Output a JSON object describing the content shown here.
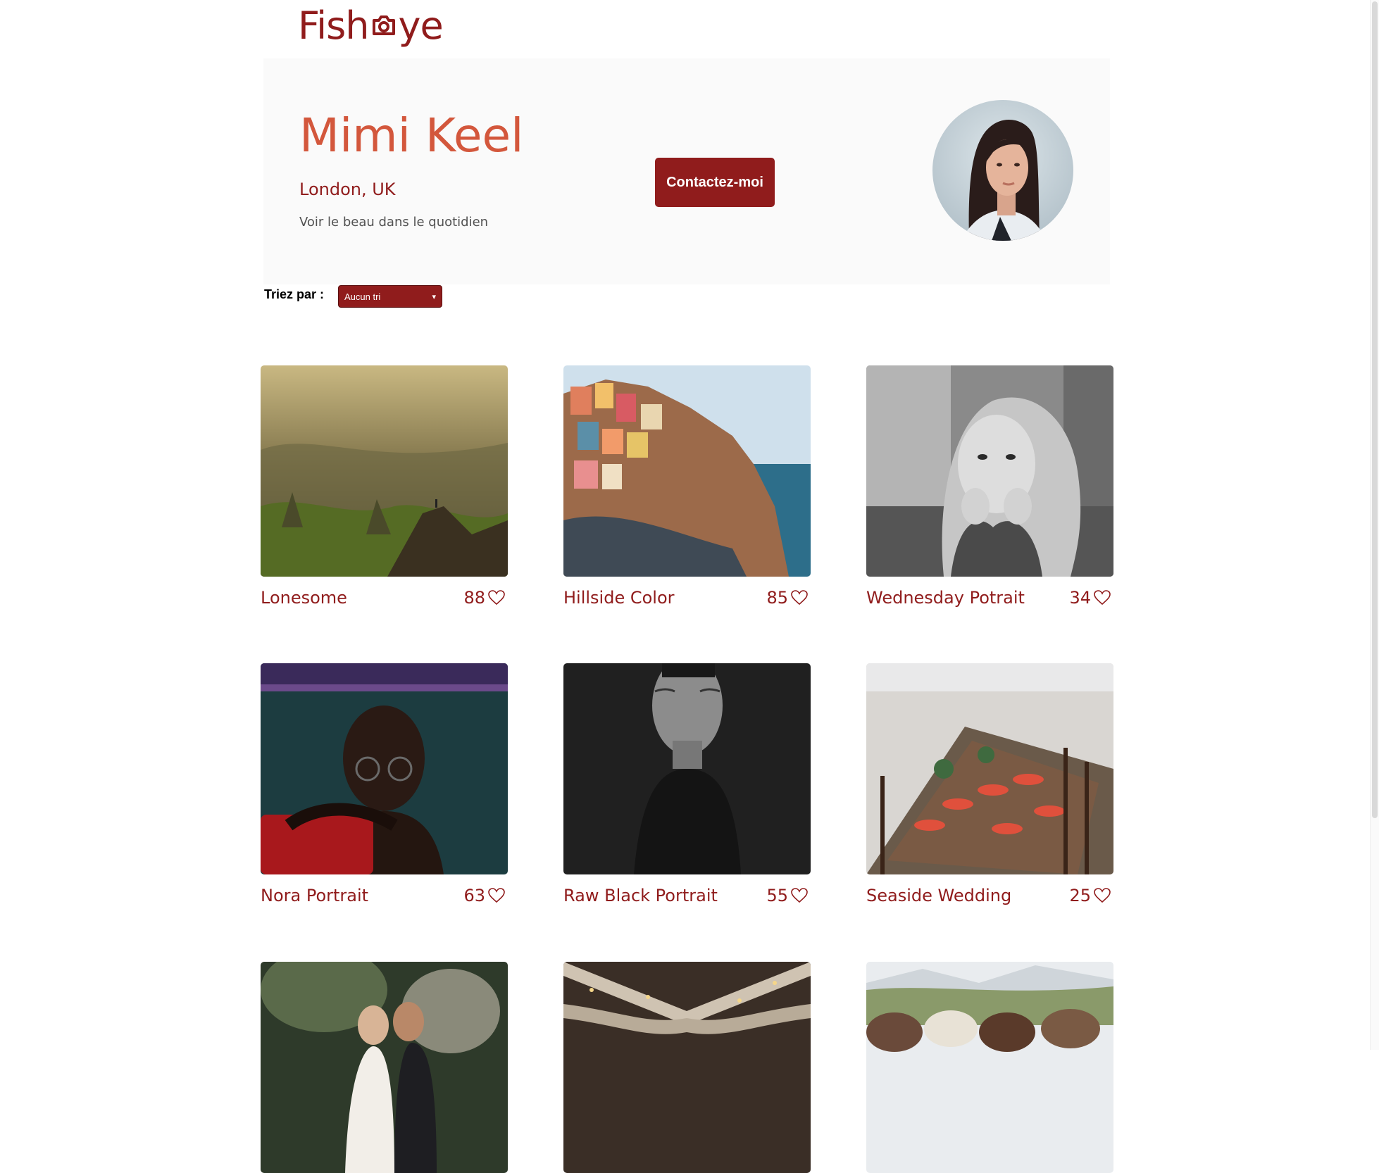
{
  "header": {
    "logo_text_start": "Fish",
    "logo_text_end": "ye",
    "brand_color": "#901C1C"
  },
  "profile": {
    "name": "Mimi Keel",
    "location": "London, UK",
    "tagline": "Voir le beau dans le quotidien",
    "contact_label": "Contactez-moi",
    "name_color": "#D3573C",
    "banner_color": "#FAFAFA"
  },
  "sort": {
    "label": "Triez par :",
    "selected": "Aucun tri"
  },
  "gallery": [
    {
      "title": "Lonesome",
      "likes": "88",
      "subject": "mountain-landscape"
    },
    {
      "title": "Hillside Color",
      "likes": "85",
      "subject": "colorful-hillside-village"
    },
    {
      "title": "Wednesday Potrait",
      "likes": "34",
      "subject": "black-white-child-portrait"
    },
    {
      "title": "Nora Portrait",
      "likes": "63",
      "subject": "woman-glasses-portrait"
    },
    {
      "title": "Raw Black Portrait",
      "likes": "55",
      "subject": "black-white-woman-portrait"
    },
    {
      "title": "Seaside Wedding",
      "likes": "25",
      "subject": "beach-wedding-table"
    },
    {
      "title": "",
      "likes": "",
      "subject": "couple-wedding-forest"
    },
    {
      "title": "",
      "likes": "",
      "subject": "wedding-tent-lights"
    },
    {
      "title": "",
      "likes": "",
      "subject": "horses-mountains"
    }
  ],
  "icons": {
    "like": "heart-outline-icon",
    "logo": "camera-icon",
    "select": "chevron-down-icon"
  }
}
